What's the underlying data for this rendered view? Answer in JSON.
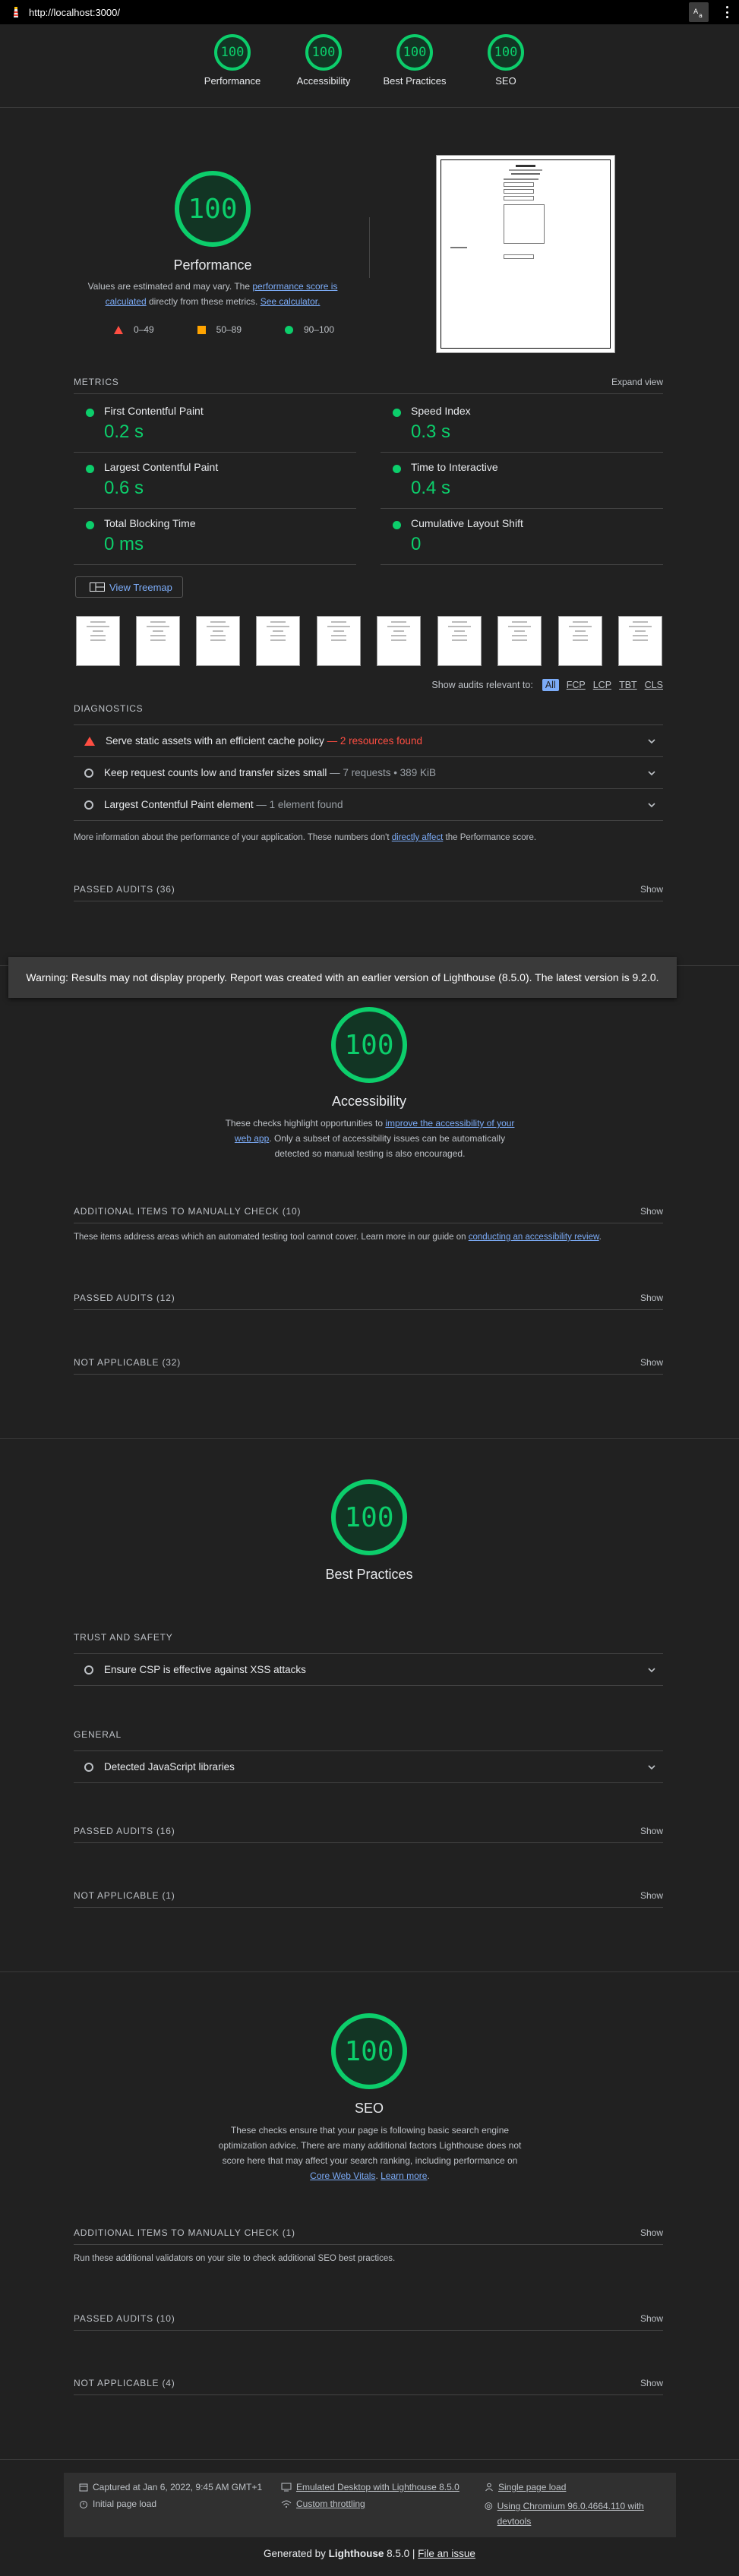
{
  "browser": {
    "url": "http://localhost:3000/"
  },
  "summary": [
    {
      "score": "100",
      "label": "Performance"
    },
    {
      "score": "100",
      "label": "Accessibility"
    },
    {
      "score": "100",
      "label": "Best Practices"
    },
    {
      "score": "100",
      "label": "SEO"
    }
  ],
  "performance": {
    "score": "100",
    "title": "Performance",
    "desc_1": "Values are estimated and may vary. The ",
    "desc_link_1": "performance score is calculated",
    "desc_2": " directly from these metrics. ",
    "desc_link_2": "See calculator.",
    "legend": [
      {
        "range": "0–49",
        "color": "#ff4e42"
      },
      {
        "range": "50–89",
        "color": "#ffa400"
      },
      {
        "range": "90–100",
        "color": "#0cce6b"
      }
    ],
    "metrics_heading": "METRICS",
    "expand_view": "Expand view",
    "metrics": [
      {
        "name": "First Contentful Paint",
        "value": "0.2 s"
      },
      {
        "name": "Speed Index",
        "value": "0.3 s"
      },
      {
        "name": "Largest Contentful Paint",
        "value": "0.6 s"
      },
      {
        "name": "Time to Interactive",
        "value": "0.4 s"
      },
      {
        "name": "Total Blocking Time",
        "value": "0 ms"
      },
      {
        "name": "Cumulative Layout Shift",
        "value": "0"
      }
    ],
    "treemap_button": "View Treemap",
    "filter_label": "Show audits relevant to:",
    "filters": [
      "All",
      "FCP",
      "LCP",
      "TBT",
      "CLS"
    ],
    "diagnostics_heading": "DIAGNOSTICS",
    "diagnostics": [
      {
        "title": "Serve static assets with an efficient cache policy",
        "detail": " — 2 resources found",
        "status": "fail"
      },
      {
        "title": "Keep request counts low and transfer sizes small",
        "detail": " — 7 requests • 389 KiB",
        "status": "info"
      },
      {
        "title": "Largest Contentful Paint element",
        "detail": " — 1 element found",
        "status": "info"
      }
    ],
    "more_info_1": "More information about the performance of your application. These numbers don't ",
    "more_info_link": "directly affect",
    "more_info_2": " the Performance score.",
    "passed": "PASSED AUDITS (36)",
    "show": "Show"
  },
  "warning": "Warning: Results may not display properly. Report was created with an earlier version of Lighthouse (8.5.0). The latest version is 9.2.0.",
  "accessibility": {
    "score": "100",
    "title": "Accessibility",
    "desc_1": "These checks highlight opportunities to ",
    "desc_link": "improve the accessibility of your web app",
    "desc_2": ". Only a subset of accessibility issues can be automatically detected so manual testing is also encouraged.",
    "manual": "ADDITIONAL ITEMS TO MANUALLY CHECK (10)",
    "manual_desc_1": "These items address areas which an automated testing tool cannot cover. Learn more in our guide on ",
    "manual_desc_link": "conducting an accessibility review",
    "manual_desc_2": ".",
    "passed": "PASSED AUDITS (12)",
    "na": "NOT APPLICABLE (32)",
    "show": "Show"
  },
  "best_practices": {
    "score": "100",
    "title": "Best Practices",
    "trust_heading": "TRUST AND SAFETY",
    "trust_audit": "Ensure CSP is effective against XSS attacks",
    "general_heading": "GENERAL",
    "general_audit": "Detected JavaScript libraries",
    "passed": "PASSED AUDITS (16)",
    "na": "NOT APPLICABLE (1)",
    "show": "Show"
  },
  "seo": {
    "score": "100",
    "title": "SEO",
    "desc_1": "These checks ensure that your page is following basic search engine optimization advice. There are many additional factors Lighthouse does not score here that may affect your search ranking, including performance on ",
    "desc_link_1": "Core Web Vitals",
    "desc_2": ". ",
    "desc_link_2": "Learn more",
    "desc_3": ".",
    "manual": "ADDITIONAL ITEMS TO MANUALLY CHECK (1)",
    "manual_desc": "Run these additional validators on your site to check additional SEO best practices.",
    "passed": "PASSED AUDITS (10)",
    "na": "NOT APPLICABLE (4)",
    "show": "Show"
  },
  "footer": {
    "captured": "Captured at Jan 6, 2022, 9:45 AM GMT+1",
    "load": "Initial page load",
    "emulated": "Emulated Desktop with Lighthouse 8.5.0",
    "throttling": "Custom throttling",
    "single": "Single page load",
    "chromium": "Using Chromium 96.0.4664.110 with devtools",
    "generated_1": "Generated by ",
    "generated_brand": "Lighthouse",
    "generated_2": " 8.5.0 | ",
    "file_issue": "File an issue"
  }
}
